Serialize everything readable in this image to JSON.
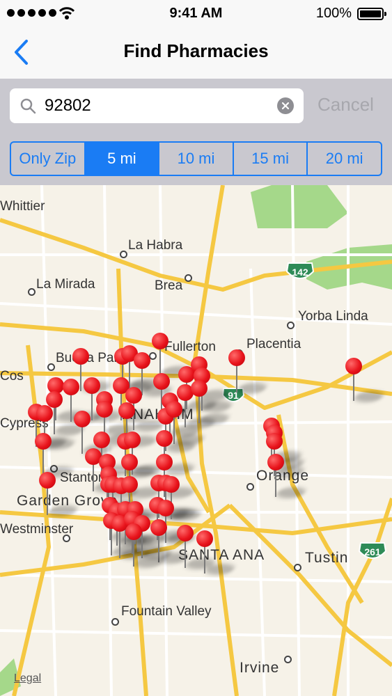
{
  "status_bar": {
    "time": "9:41 AM",
    "battery": "100%"
  },
  "nav": {
    "title": "Find Pharmacies",
    "back_icon": "chevron-left-icon"
  },
  "search": {
    "value": "92802",
    "placeholder": "Search",
    "cancel_label": "Cancel"
  },
  "radius_filter": {
    "options": [
      "Only Zip",
      "5 mi",
      "10 mi",
      "15 mi",
      "20 mi"
    ],
    "selected": "5 mi"
  },
  "map": {
    "places": [
      "Whittier",
      "La Habra",
      "La Mirada",
      "Brea",
      "Yorba Linda",
      "Fullerton",
      "Placentia",
      "Buena Park",
      "Cos",
      "Cypress",
      "ANAHEIM",
      "Stanton",
      "Garden Grove",
      "Orange",
      "Westminster",
      "SANTA ANA",
      "Tustin",
      "Fountain Valley",
      "Irvine"
    ],
    "highways": [
      "142",
      "91",
      "261"
    ],
    "legal": "Legal",
    "pharmacy_pin_count": 64
  },
  "colors": {
    "accent": "#1a7cf4",
    "pin": "#e8141c",
    "road": "#f5c842",
    "park": "#a5d88a"
  }
}
